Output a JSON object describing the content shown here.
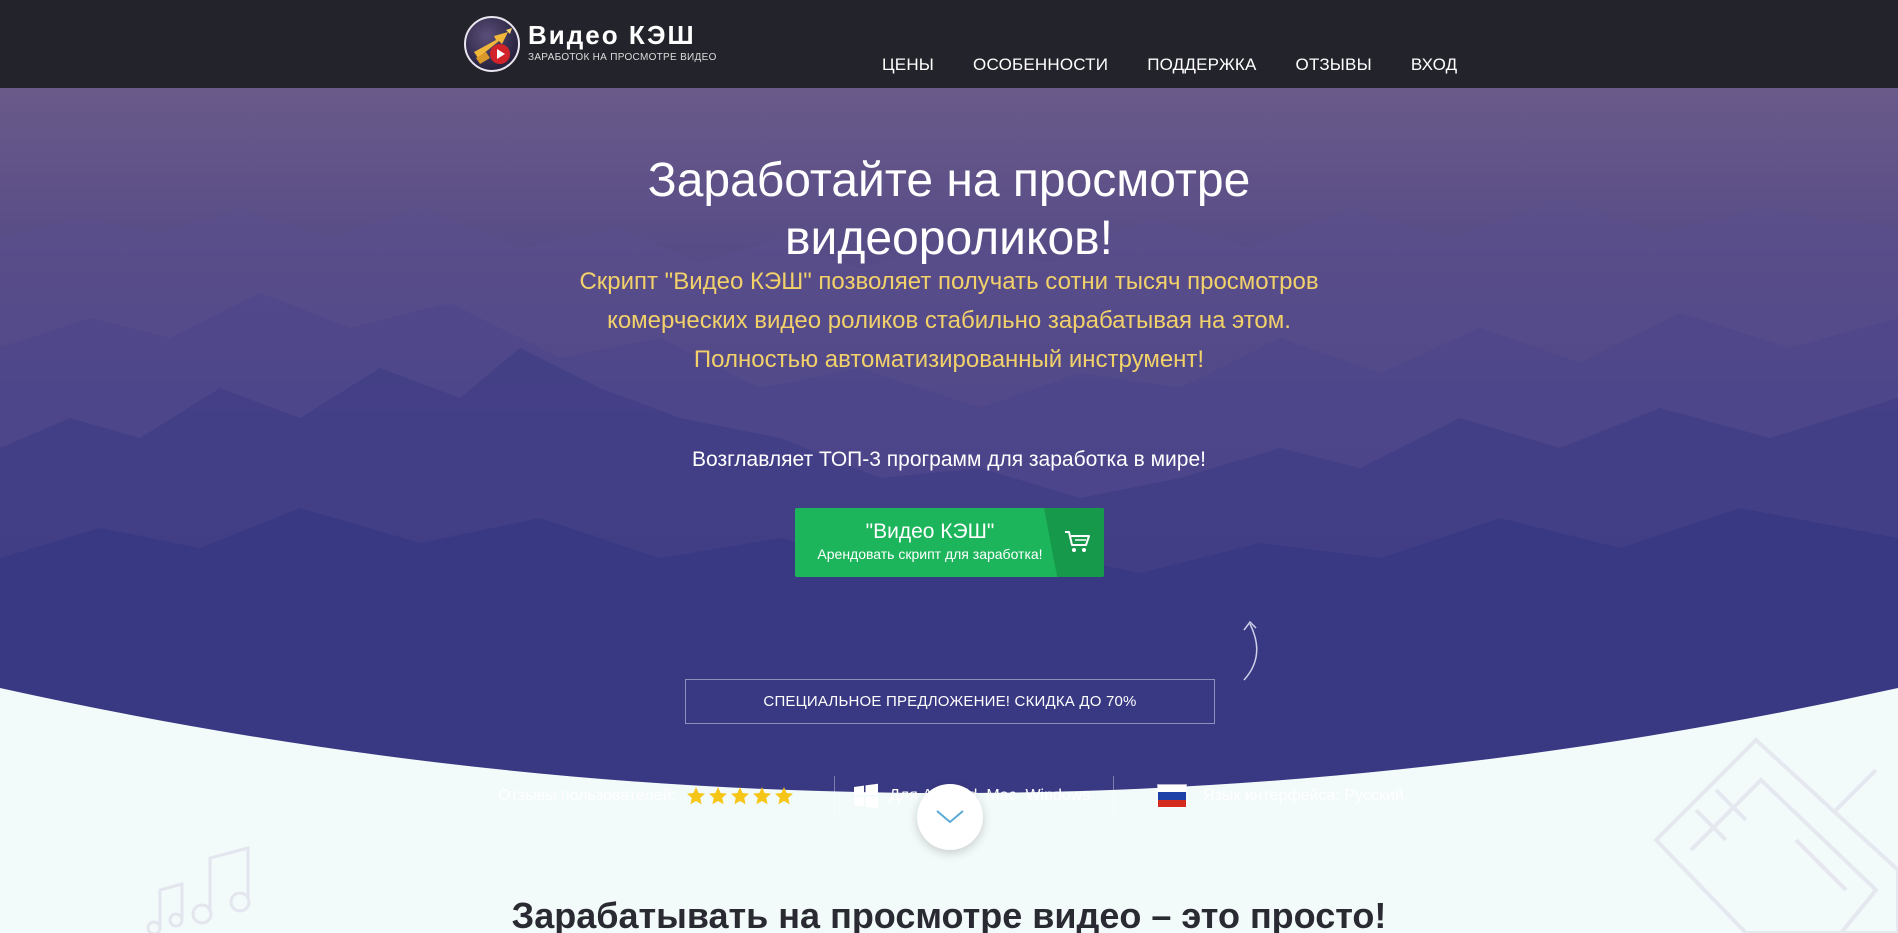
{
  "header": {
    "logo_title": "Видео КЭШ",
    "logo_subtitle": "ЗАРАБОТОК НА ПРОСМОТРЕ ВИДЕО",
    "nav": [
      "ЦЕНЫ",
      "ОСОБЕННОСТИ",
      "ПОДДЕРЖКА",
      "ОТЗЫВЫ",
      "ВХОД"
    ]
  },
  "hero": {
    "title_line1": "Заработайте на просмотре",
    "title_line2": "видеороликов!",
    "desc_line1": "Скрипт \"Видео КЭШ\" позволяет получать сотни тысяч просмотров",
    "desc_line2": "комерческих видео роликов стабильно зарабатывая на этом.",
    "desc_line3": "Полностью автоматизированный инструмент!",
    "tagline": "Возглавляет ТОП-3 программ для заработка в мире!"
  },
  "cta": {
    "title": "\"Видео КЭШ\"",
    "subtitle": "Арендовать скрипт для заработка!",
    "cart_icon": "shopping-cart-icon"
  },
  "offer": {
    "label": "СПЕЦИАЛЬНОЕ ПРЕДЛОЖЕНИЕ! СКИДКА ДО 70%"
  },
  "features": {
    "reviews_label": "Отзывы пользователей:",
    "rating_stars": 5,
    "platforms_label": "Для Android, Mac, Windows",
    "language_label": "Язык интерфейса: Русский"
  },
  "section": {
    "title": "Зарабатывать на просмотре видео – это просто!"
  },
  "colors": {
    "header_bg": "#23232b",
    "accent_yellow": "#f2d16a",
    "cta_green": "#1db55b",
    "cta_green_dark": "#17994c",
    "star_yellow": "#f5c518"
  }
}
